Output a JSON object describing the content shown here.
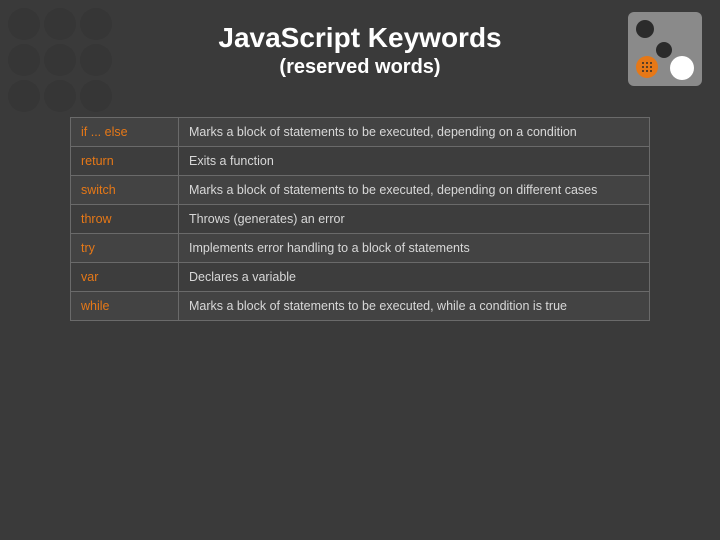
{
  "header": {
    "title": "JavaScript Keywords",
    "subtitle": "(reserved words)"
  },
  "table": {
    "rows": [
      {
        "keyword": "if ... else",
        "description": "Marks a block of statements to be executed, depending on a condition"
      },
      {
        "keyword": "return",
        "description": "Exits a function"
      },
      {
        "keyword": "switch",
        "description": "Marks a block of statements to be executed, depending on different cases"
      },
      {
        "keyword": "throw",
        "description": "Throws (generates) an error"
      },
      {
        "keyword": "try",
        "description": "Implements error handling to a block of statements"
      },
      {
        "keyword": "var",
        "description": "Declares a variable"
      },
      {
        "keyword": "while",
        "description": "Marks a block of statements to be executed, while a condition is true"
      }
    ]
  }
}
